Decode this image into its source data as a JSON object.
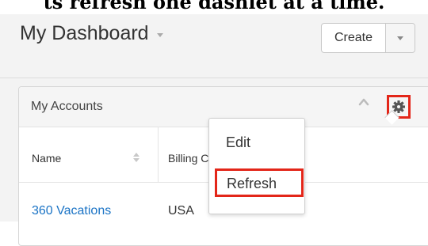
{
  "caption": "ts refresh one dashlet at a time.",
  "header": {
    "title": "My Dashboard",
    "create_label": "Create"
  },
  "dashlet": {
    "title": "My Accounts",
    "columns": [
      "Name",
      "Billing C"
    ],
    "rows": [
      {
        "name": "360 Vacations",
        "country": "USA"
      }
    ]
  },
  "menu": {
    "items": [
      "Edit",
      "Refresh"
    ]
  },
  "icons": {
    "title_caret": "chevron-down-icon",
    "create_caret": "chevron-down-icon",
    "collapse": "chevron-up-icon",
    "settings": "gear-icon",
    "sort": "sort-icon"
  },
  "colors": {
    "highlight": "#e32619",
    "link": "#1a73c5",
    "background": "#f3f3f3"
  }
}
